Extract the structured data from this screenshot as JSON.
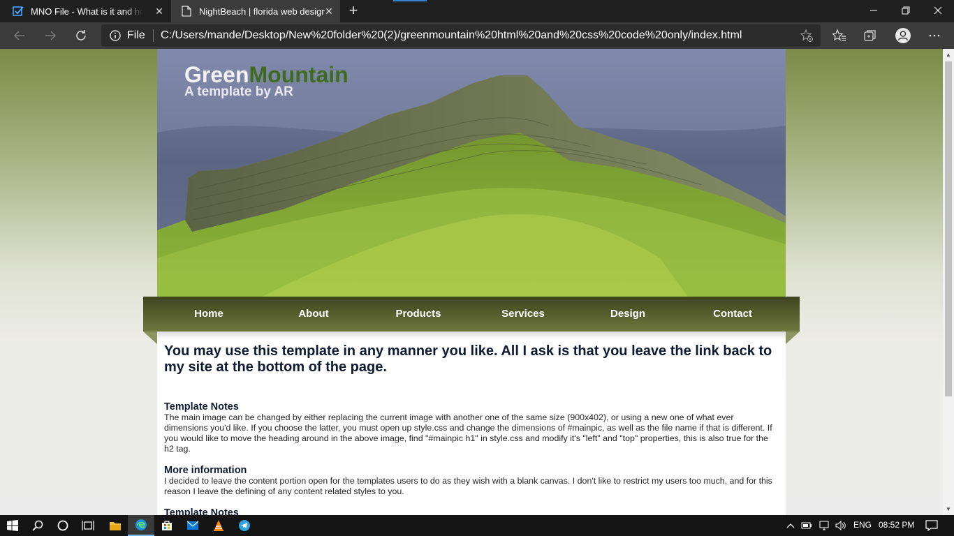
{
  "browser": {
    "tabs": [
      {
        "title": "MNO File - What is it and how do",
        "active": false
      },
      {
        "title": "NightBeach | florida web design",
        "active": true
      }
    ],
    "new_tab_glyph": "+",
    "window_controls": {
      "minimize": "—",
      "restore": "❐",
      "close": "✕"
    },
    "address": {
      "scheme_label": "File",
      "url": "C:/Users/mande/Desktop/New%20folder%20(2)/greenmountain%20html%20and%20css%20code%20only/index.html"
    },
    "toolbar_icons": [
      "back-icon",
      "forward-icon",
      "refresh-icon",
      "info-icon",
      "add-favorite-icon",
      "favorites-icon",
      "collections-icon",
      "profile-icon",
      "more-icon"
    ]
  },
  "site": {
    "title_part1": "Green",
    "title_part2": "Mountain",
    "subtitle": "A template by AR",
    "menu": [
      "Home",
      "About",
      "Products",
      "Services",
      "Design",
      "Contact"
    ],
    "intro_heading": "You may use this template in any manner you like. All I ask is that you leave the link back to my site at the bottom of the page.",
    "sections": [
      {
        "heading": "Template Notes",
        "body": "The main image can be changed by either replacing the current image with another one of the same size (900x402), or using a new one of what ever dimensions you'd like. If you choose the latter, you must open up style.css and change the dimensions of #mainpic, as well as the file name if that is different. If you would like to move the heading around in the above image, find \"#mainpic h1\" in style.css and modify it's \"left\" and \"top\" properties, this is also true for the h2 tag."
      },
      {
        "heading": "More information",
        "body": "I decided to leave the content portion open for the templates users to do as they wish with a blank canvas. I don't like to restrict my users too much, and for this reason I leave the defining of any content related styles to you."
      },
      {
        "heading": "Template Notes",
        "body": ""
      }
    ],
    "colors": {
      "menu_dark": "#3d4420",
      "menu_light": "#6f7740",
      "title_green": "#3f6b1f",
      "heading_text": "#0f1a33"
    }
  },
  "taskbar": {
    "icons": [
      "windows-start-icon",
      "search-icon",
      "cortana-icon",
      "task-view-icon",
      "file-explorer-icon",
      "edge-icon",
      "store-icon",
      "mail-icon",
      "vlc-icon",
      "telegram-icon"
    ],
    "tray": {
      "language": "ENG",
      "time": "08:52 PM"
    }
  }
}
